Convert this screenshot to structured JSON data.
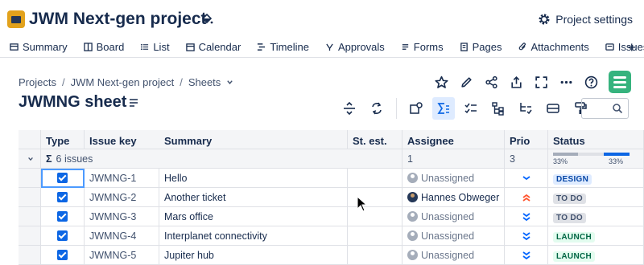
{
  "project": {
    "title": "JWM Next-gen project",
    "settings_label": "Project settings"
  },
  "tabs": [
    {
      "label": "Summary",
      "icon": "summary-icon"
    },
    {
      "label": "Board",
      "icon": "board-icon"
    },
    {
      "label": "List",
      "icon": "list-icon"
    },
    {
      "label": "Calendar",
      "icon": "calendar-icon"
    },
    {
      "label": "Timeline",
      "icon": "timeline-icon"
    },
    {
      "label": "Approvals",
      "icon": "approvals-icon"
    },
    {
      "label": "Forms",
      "icon": "forms-icon"
    },
    {
      "label": "Pages",
      "icon": "pages-icon"
    },
    {
      "label": "Attachments",
      "icon": "attachment-icon"
    },
    {
      "label": "Issues",
      "icon": "issues-icon"
    }
  ],
  "breadcrumb": {
    "items": [
      "Projects",
      "JWM Next-gen project",
      "Sheets"
    ],
    "separator": "/"
  },
  "sheet": {
    "title": "JWMNG sheet"
  },
  "table": {
    "headers": {
      "type": "Type",
      "key": "Issue key",
      "summary": "Summary",
      "estimate": "St. est.",
      "assignee": "Assignee",
      "priority": "Prio",
      "status": "Status"
    },
    "summary_row": {
      "issue_count": "6 issues",
      "sigma": "Σ",
      "assignee_count": "1",
      "priority_count": "3",
      "status_pct_left": "33%",
      "status_pct_right": "33%",
      "status_fractions": [
        0.33,
        0.33,
        0.34
      ]
    },
    "rows": [
      {
        "key": "JWMNG-1",
        "summary": "Hello",
        "assignee": "Unassigned",
        "priority": "low",
        "status": "DESIGN",
        "status_class": "lz-design"
      },
      {
        "key": "JWMNG-2",
        "summary": "Another ticket",
        "assignee": "Hannes Obweger",
        "priority": "high",
        "status": "TO DO",
        "status_class": "lz-todo"
      },
      {
        "key": "JWMNG-3",
        "summary": "Mars office",
        "assignee": "Unassigned",
        "priority": "lowest",
        "status": "TO DO",
        "status_class": "lz-todo"
      },
      {
        "key": "JWMNG-4",
        "summary": "Interplanet connectivity",
        "assignee": "Unassigned",
        "priority": "lowest",
        "status": "LAUNCH",
        "status_class": "lz-launch"
      },
      {
        "key": "JWMNG-5",
        "summary": "Jupiter hub",
        "assignee": "Unassigned",
        "priority": "lowest",
        "status": "LAUNCH",
        "status_class": "lz-launch"
      }
    ]
  },
  "colors": {
    "accent": "#0c66e4",
    "brand_green": "#36b37e",
    "priority_low": "#0065ff",
    "priority_high": "#ff5630",
    "status_bar_grey": "#a5adba",
    "status_bar_blue": "#0c66e4"
  }
}
